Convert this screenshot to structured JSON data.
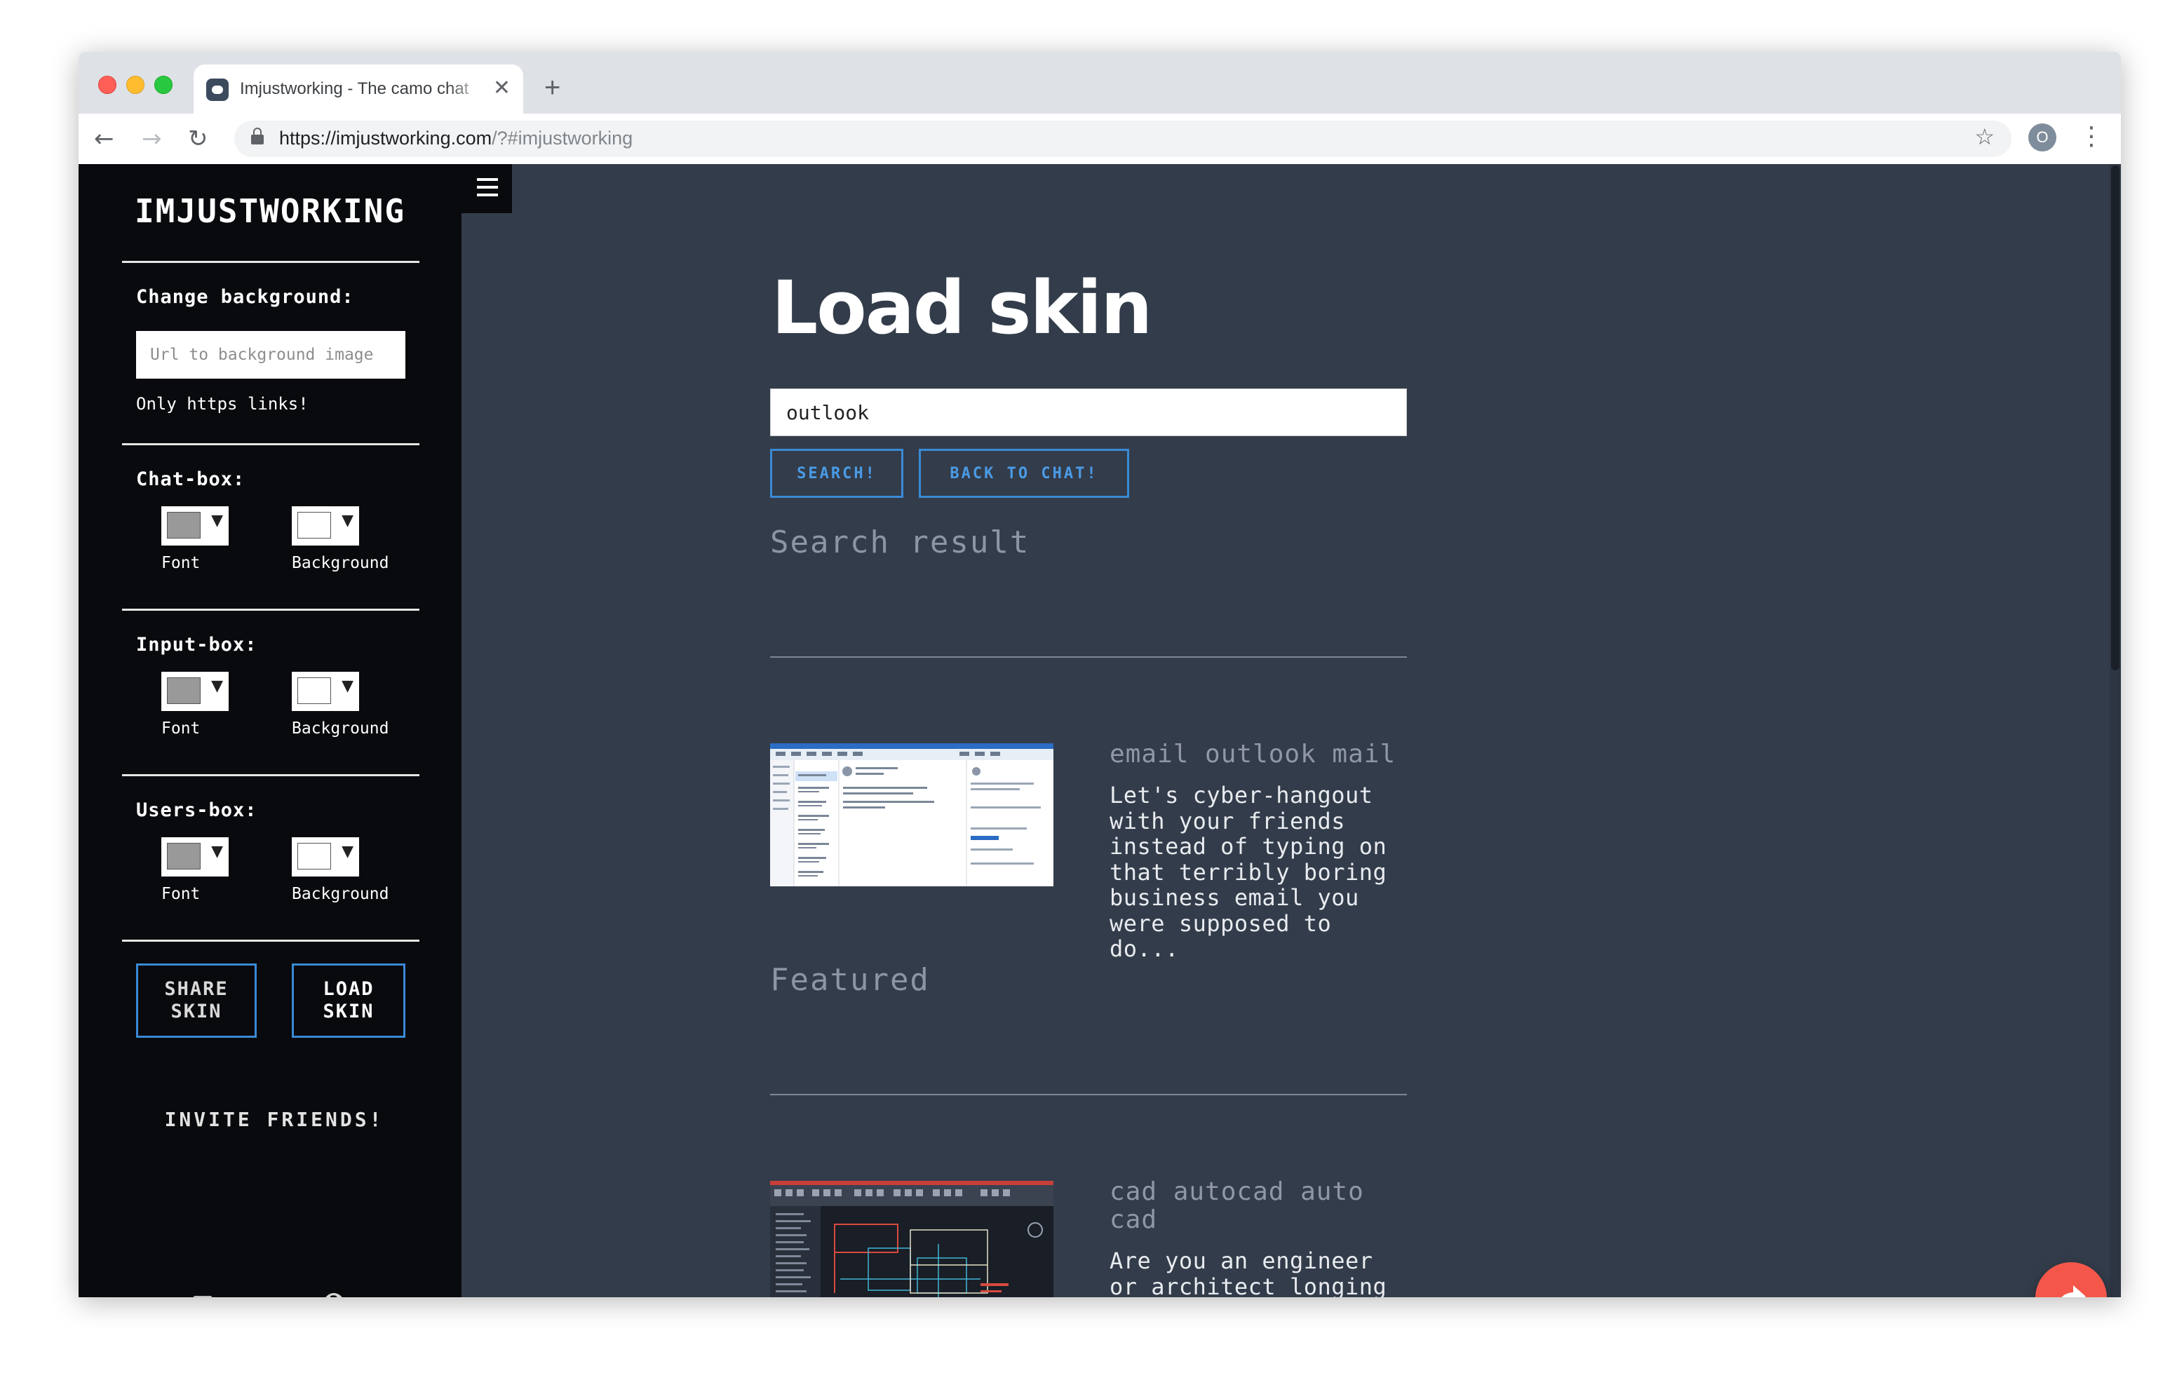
{
  "browser": {
    "tab_title": "Imjustworking - The camo chat",
    "url_host": "https://imjustworking.com",
    "url_path": "/?#imjustworking",
    "new_tab": "+",
    "close_tab": "✕",
    "profile_initial": "O"
  },
  "sidebar": {
    "brand": "IMJUSTWORKING",
    "change_background_label": "Change background:",
    "background_placeholder": "Url to background image",
    "background_note": "Only https links!",
    "sections": [
      {
        "label": "Chat-box:",
        "font_label": "Font",
        "bg_label": "Background",
        "font_color": "#999999",
        "bg_color": "#ffffff"
      },
      {
        "label": "Input-box:",
        "font_label": "Font",
        "bg_label": "Background",
        "font_color": "#999999",
        "bg_color": "#ffffff"
      },
      {
        "label": "Users-box:",
        "font_label": "Font",
        "bg_label": "Background",
        "font_color": "#999999",
        "bg_color": "#ffffff"
      }
    ],
    "share_skin": "SHARE SKIN",
    "load_skin": "LOAD SKIN",
    "invite": "INVITE FRIENDS!",
    "footer_icons": [
      "document-icon",
      "gear-icon",
      "help-icon"
    ]
  },
  "main": {
    "title": "Load skin",
    "search_value": "outlook",
    "search_button": "SEARCH!",
    "back_button": "BACK TO CHAT!",
    "search_result_heading": "Search result",
    "featured_heading": "Featured",
    "results": [
      {
        "title": "email outlook mail",
        "description": "Let's cyber-hangout with your friends instead of typing on that terribly boring business email you were supposed to do..."
      }
    ],
    "featured": [
      {
        "title": "cad autocad auto cad",
        "description": "Are you an engineer or architect longing for some companionship with"
      }
    ]
  },
  "colors": {
    "sidebar_bg": "#090a0d",
    "main_bg": "#333c4a",
    "accent_blue": "#3a8ad6",
    "share_fab": "#f4574a"
  }
}
